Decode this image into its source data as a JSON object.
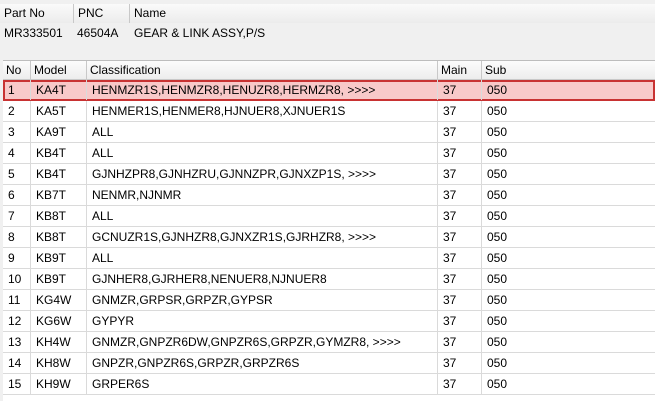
{
  "part_header": {
    "labels": {
      "part_no": "Part No",
      "pnc": "PNC",
      "name": "Name"
    },
    "values": {
      "part_no": "MR333501",
      "pnc": "46504A",
      "name": "GEAR & LINK ASSY,P/S"
    }
  },
  "table": {
    "headers": {
      "no": "No",
      "model": "Model",
      "classification": "Classification",
      "main": "Main",
      "sub": "Sub"
    },
    "selected_index": 0,
    "rows": [
      {
        "no": "1",
        "model": "KA4T",
        "classification": "HENMZR1S,HENMZR8,HENUZR8,HERMZR8,  >>>>",
        "main": "37",
        "sub": "050"
      },
      {
        "no": "2",
        "model": "KA5T",
        "classification": "HENMER1S,HENMER8,HJNUER8,XJNUER1S",
        "main": "37",
        "sub": "050"
      },
      {
        "no": "3",
        "model": "KA9T",
        "classification": "ALL",
        "main": "37",
        "sub": "050"
      },
      {
        "no": "4",
        "model": "KB4T",
        "classification": "ALL",
        "main": "37",
        "sub": "050"
      },
      {
        "no": "5",
        "model": "KB4T",
        "classification": "GJNHZPR8,GJNHZRU,GJNNZPR,GJNXZP1S,  >>>>",
        "main": "37",
        "sub": "050"
      },
      {
        "no": "6",
        "model": "KB7T",
        "classification": "NENMR,NJNMR",
        "main": "37",
        "sub": "050"
      },
      {
        "no": "7",
        "model": "KB8T",
        "classification": "ALL",
        "main": "37",
        "sub": "050"
      },
      {
        "no": "8",
        "model": "KB8T",
        "classification": "GCNUZR1S,GJNHZR8,GJNXZR1S,GJRHZR8,  >>>>",
        "main": "37",
        "sub": "050"
      },
      {
        "no": "9",
        "model": "KB9T",
        "classification": "ALL",
        "main": "37",
        "sub": "050"
      },
      {
        "no": "10",
        "model": "KB9T",
        "classification": "GJNHER8,GJRHER8,NENUER8,NJNUER8",
        "main": "37",
        "sub": "050"
      },
      {
        "no": "11",
        "model": "KG4W",
        "classification": "GNMZR,GRPSR,GRPZR,GYPSR",
        "main": "37",
        "sub": "050"
      },
      {
        "no": "12",
        "model": "KG6W",
        "classification": "GYPYR",
        "main": "37",
        "sub": "050"
      },
      {
        "no": "13",
        "model": "KH4W",
        "classification": "GNMZR,GNPZR6DW,GNPZR6S,GRPZR,GYMZR8,  >>>>",
        "main": "37",
        "sub": "050"
      },
      {
        "no": "14",
        "model": "KH8W",
        "classification": "GNPZR,GNPZR6S,GRPZR,GRPZR6S",
        "main": "37",
        "sub": "050"
      },
      {
        "no": "15",
        "model": "KH9W",
        "classification": "GRPER6S",
        "main": "37",
        "sub": "050"
      }
    ]
  }
}
